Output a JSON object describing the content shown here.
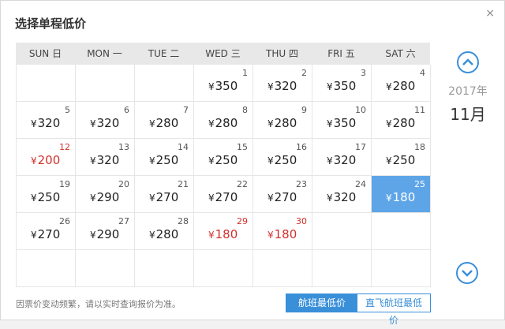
{
  "dialog": {
    "title": "选择单程低价",
    "close_label": "×"
  },
  "calendar": {
    "weekdays": [
      "SUN 日",
      "MON 一",
      "TUE 二",
      "WED 三",
      "THU 四",
      "FRI 五",
      "SAT 六"
    ],
    "year_label": "2017年",
    "month_label": "11月",
    "cells": [
      {
        "day": "",
        "price": ""
      },
      {
        "day": "",
        "price": ""
      },
      {
        "day": "",
        "price": ""
      },
      {
        "day": "1",
        "price": "350"
      },
      {
        "day": "2",
        "price": "320"
      },
      {
        "day": "3",
        "price": "350"
      },
      {
        "day": "4",
        "price": "280"
      },
      {
        "day": "5",
        "price": "320"
      },
      {
        "day": "6",
        "price": "320"
      },
      {
        "day": "7",
        "price": "280"
      },
      {
        "day": "8",
        "price": "280"
      },
      {
        "day": "9",
        "price": "280"
      },
      {
        "day": "10",
        "price": "350"
      },
      {
        "day": "11",
        "price": "280"
      },
      {
        "day": "12",
        "price": "200",
        "low": true
      },
      {
        "day": "13",
        "price": "320"
      },
      {
        "day": "14",
        "price": "250"
      },
      {
        "day": "15",
        "price": "250"
      },
      {
        "day": "16",
        "price": "250"
      },
      {
        "day": "17",
        "price": "320"
      },
      {
        "day": "18",
        "price": "250"
      },
      {
        "day": "19",
        "price": "250"
      },
      {
        "day": "20",
        "price": "290"
      },
      {
        "day": "21",
        "price": "270"
      },
      {
        "day": "22",
        "price": "270"
      },
      {
        "day": "23",
        "price": "270"
      },
      {
        "day": "24",
        "price": "320"
      },
      {
        "day": "25",
        "price": "180",
        "selected": true
      },
      {
        "day": "26",
        "price": "270"
      },
      {
        "day": "27",
        "price": "290"
      },
      {
        "day": "28",
        "price": "280"
      },
      {
        "day": "29",
        "price": "180",
        "low": true
      },
      {
        "day": "30",
        "price": "180",
        "low": true
      },
      {
        "day": "",
        "price": ""
      },
      {
        "day": "",
        "price": ""
      },
      {
        "day": "",
        "price": ""
      },
      {
        "day": "",
        "price": ""
      },
      {
        "day": "",
        "price": ""
      },
      {
        "day": "",
        "price": ""
      },
      {
        "day": "",
        "price": ""
      },
      {
        "day": "",
        "price": ""
      },
      {
        "day": "",
        "price": ""
      }
    ]
  },
  "footer": {
    "note": "因票价变动频繁，请以实时查询报价为准。",
    "tab_lowest_label": "航班最低价",
    "tab_direct_label": "直飞航班最低价"
  },
  "colors": {
    "accent": "#3a8fd9",
    "selected_bg": "#5ea5e8",
    "low_price": "#d0302c"
  },
  "icons": {
    "prev": "chevron-up-circle-icon",
    "next": "chevron-down-circle-icon",
    "close": "close-icon"
  }
}
